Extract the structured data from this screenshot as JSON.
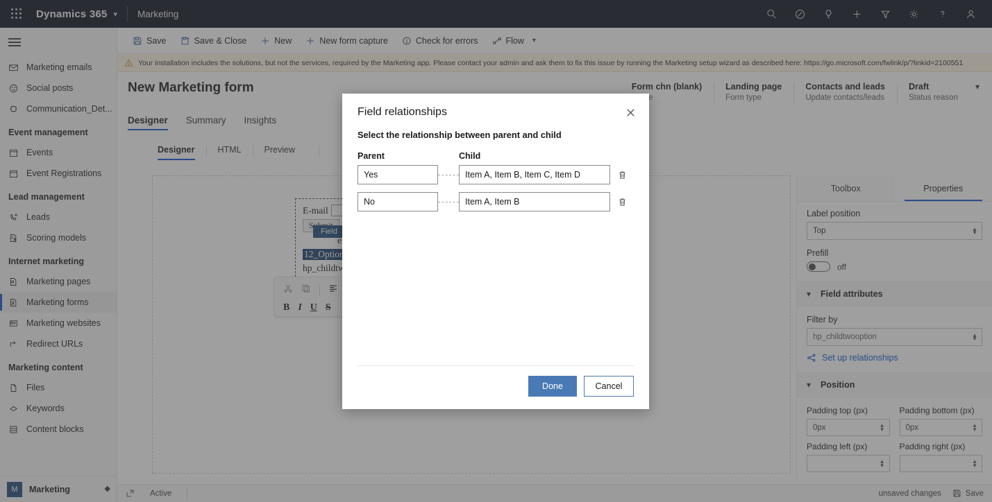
{
  "suitebar": {
    "waffle_label": "app-launcher",
    "brand": "Dynamics 365",
    "app_name": "Marketing",
    "icons": [
      "search-icon",
      "pulse-icon",
      "lightbulb-icon",
      "plus-icon",
      "filter-icon",
      "gear-icon",
      "help-icon",
      "account-icon"
    ]
  },
  "leftnav": {
    "items": [
      {
        "label": "Marketing emails",
        "icon": "envelope-icon",
        "type": "item",
        "selected": false
      },
      {
        "label": "Social posts",
        "icon": "smiley-icon",
        "type": "item",
        "selected": false
      },
      {
        "label": "Communication_Det...",
        "icon": "puzzle-icon",
        "type": "item",
        "selected": false
      },
      {
        "label": "Event management",
        "type": "group"
      },
      {
        "label": "Events",
        "icon": "calendar-icon",
        "type": "item",
        "selected": false
      },
      {
        "label": "Event Registrations",
        "icon": "calendar-icon",
        "type": "item",
        "selected": false
      },
      {
        "label": "Lead management",
        "type": "group"
      },
      {
        "label": "Leads",
        "icon": "phone-icon",
        "type": "item",
        "selected": false
      },
      {
        "label": "Scoring models",
        "icon": "document-person-icon",
        "type": "item",
        "selected": false
      },
      {
        "label": "Internet marketing",
        "type": "group"
      },
      {
        "label": "Marketing pages",
        "icon": "page-icon",
        "type": "item",
        "selected": false
      },
      {
        "label": "Marketing forms",
        "icon": "form-icon",
        "type": "item",
        "selected": true
      },
      {
        "label": "Marketing websites",
        "icon": "website-icon",
        "type": "item",
        "selected": false
      },
      {
        "label": "Redirect URLs",
        "icon": "redirect-arrow-icon",
        "type": "item",
        "selected": false
      },
      {
        "label": "Marketing content",
        "type": "group"
      },
      {
        "label": "Files",
        "icon": "file-icon",
        "type": "item",
        "selected": false
      },
      {
        "label": "Keywords",
        "icon": "tag-icon",
        "type": "item",
        "selected": false
      },
      {
        "label": "Content blocks",
        "icon": "blocks-icon",
        "type": "item",
        "selected": false
      }
    ],
    "footer": {
      "initial": "M",
      "label": "Marketing"
    }
  },
  "commandbar": {
    "items": [
      {
        "label": "Save",
        "icon": "save-icon"
      },
      {
        "label": "Save & Close",
        "icon": "save-close-icon"
      },
      {
        "label": "New",
        "icon": "plus-icon"
      },
      {
        "label": "New form capture",
        "icon": "plus-icon"
      },
      {
        "label": "Check for errors",
        "icon": "alert-circle-icon"
      },
      {
        "label": "Flow",
        "icon": "flow-icon"
      }
    ]
  },
  "warning": {
    "icon": "warning-triangle-icon",
    "text": "Your installation includes the solutions, but not the services, required by the Marketing app. Please contact your admin and ask them to fix this issue by running the Marketing setup wizard as described here: https://go.microsoft.com/fwlink/p/?linkid=2100551"
  },
  "form_header": {
    "title": "New Marketing form",
    "tabs": [
      {
        "label": "Designer",
        "active": true
      },
      {
        "label": "Summary",
        "active": false
      },
      {
        "label": "Insights",
        "active": false
      }
    ],
    "facts": [
      {
        "value": "Form chn (blank)",
        "label": "Name"
      },
      {
        "value": "Landing page",
        "label": "Form type"
      },
      {
        "value": "Contacts and leads",
        "label": "Update contacts/leads"
      },
      {
        "value": "Draft",
        "label": "Status reason"
      }
    ],
    "caret": "chevron-down-icon"
  },
  "designer_toolbar": {
    "tabs": [
      {
        "label": "Designer",
        "active": true
      },
      {
        "label": "HTML",
        "active": false
      },
      {
        "label": "Preview",
        "active": false
      }
    ],
    "undo_icon": "undo-icon"
  },
  "canvas": {
    "form": {
      "email_label": "E-mail",
      "submit_label": "Submit",
      "field_badge": "Field",
      "line_partial": "entlo",
      "selected_text": "12_Option",
      "bottom_text": "hp_childtw"
    },
    "format_toolbar": {
      "row1": [
        "cut-icon",
        "copy-icon",
        "align-left-icon",
        "align-center-icon"
      ],
      "row2": [
        "bold-icon",
        "italic-icon",
        "underline-icon",
        "strikethrough-icon"
      ]
    }
  },
  "properties_panel": {
    "tabs": [
      {
        "label": "Toolbox",
        "active": false
      },
      {
        "label": "Properties",
        "active": true
      }
    ],
    "label_position": {
      "label": "Label position",
      "value": "Top"
    },
    "prefill": {
      "label": "Prefill",
      "state": "off"
    },
    "field_attributes_section": {
      "label": "Field attributes",
      "chevron": "chevron-down-icon"
    },
    "filter_by": {
      "label": "Filter by",
      "value": "hp_childtwooption"
    },
    "setup_relationships": {
      "label": "Set up relationships",
      "icon": "share-nodes-icon"
    },
    "position_section": {
      "label": "Position",
      "chevron": "chevron-down-icon"
    },
    "padding": [
      {
        "label": "Padding top (px)",
        "value": "0px"
      },
      {
        "label": "Padding bottom (px)",
        "value": "0px"
      },
      {
        "label": "Padding left (px)",
        "value": ""
      },
      {
        "label": "Padding right (px)",
        "value": ""
      }
    ]
  },
  "statusbar": {
    "popout_icon": "popout-icon",
    "status": "Active",
    "unsaved": "unsaved changes",
    "save_label": "Save",
    "save_icon": "save-icon"
  },
  "modal": {
    "title": "Field relationships",
    "close_icon": "close-icon",
    "subtitle": "Select the relationship between parent and child",
    "headers": {
      "parent": "Parent",
      "child": "Child"
    },
    "rows": [
      {
        "parent": "Yes",
        "child": "Item A, Item B, Item C, Item D",
        "delete_icon": "trash-icon"
      },
      {
        "parent": "No",
        "child": "Item A, Item B",
        "delete_icon": "trash-icon"
      }
    ],
    "done_label": "Done",
    "cancel_label": "Cancel"
  },
  "colors": {
    "suitebar_bg": "#0b1021",
    "accent": "#0b53ce",
    "primary_button": "#4a7ab5",
    "warning_bg": "#fdf4e3",
    "link": "#0b53ce"
  }
}
